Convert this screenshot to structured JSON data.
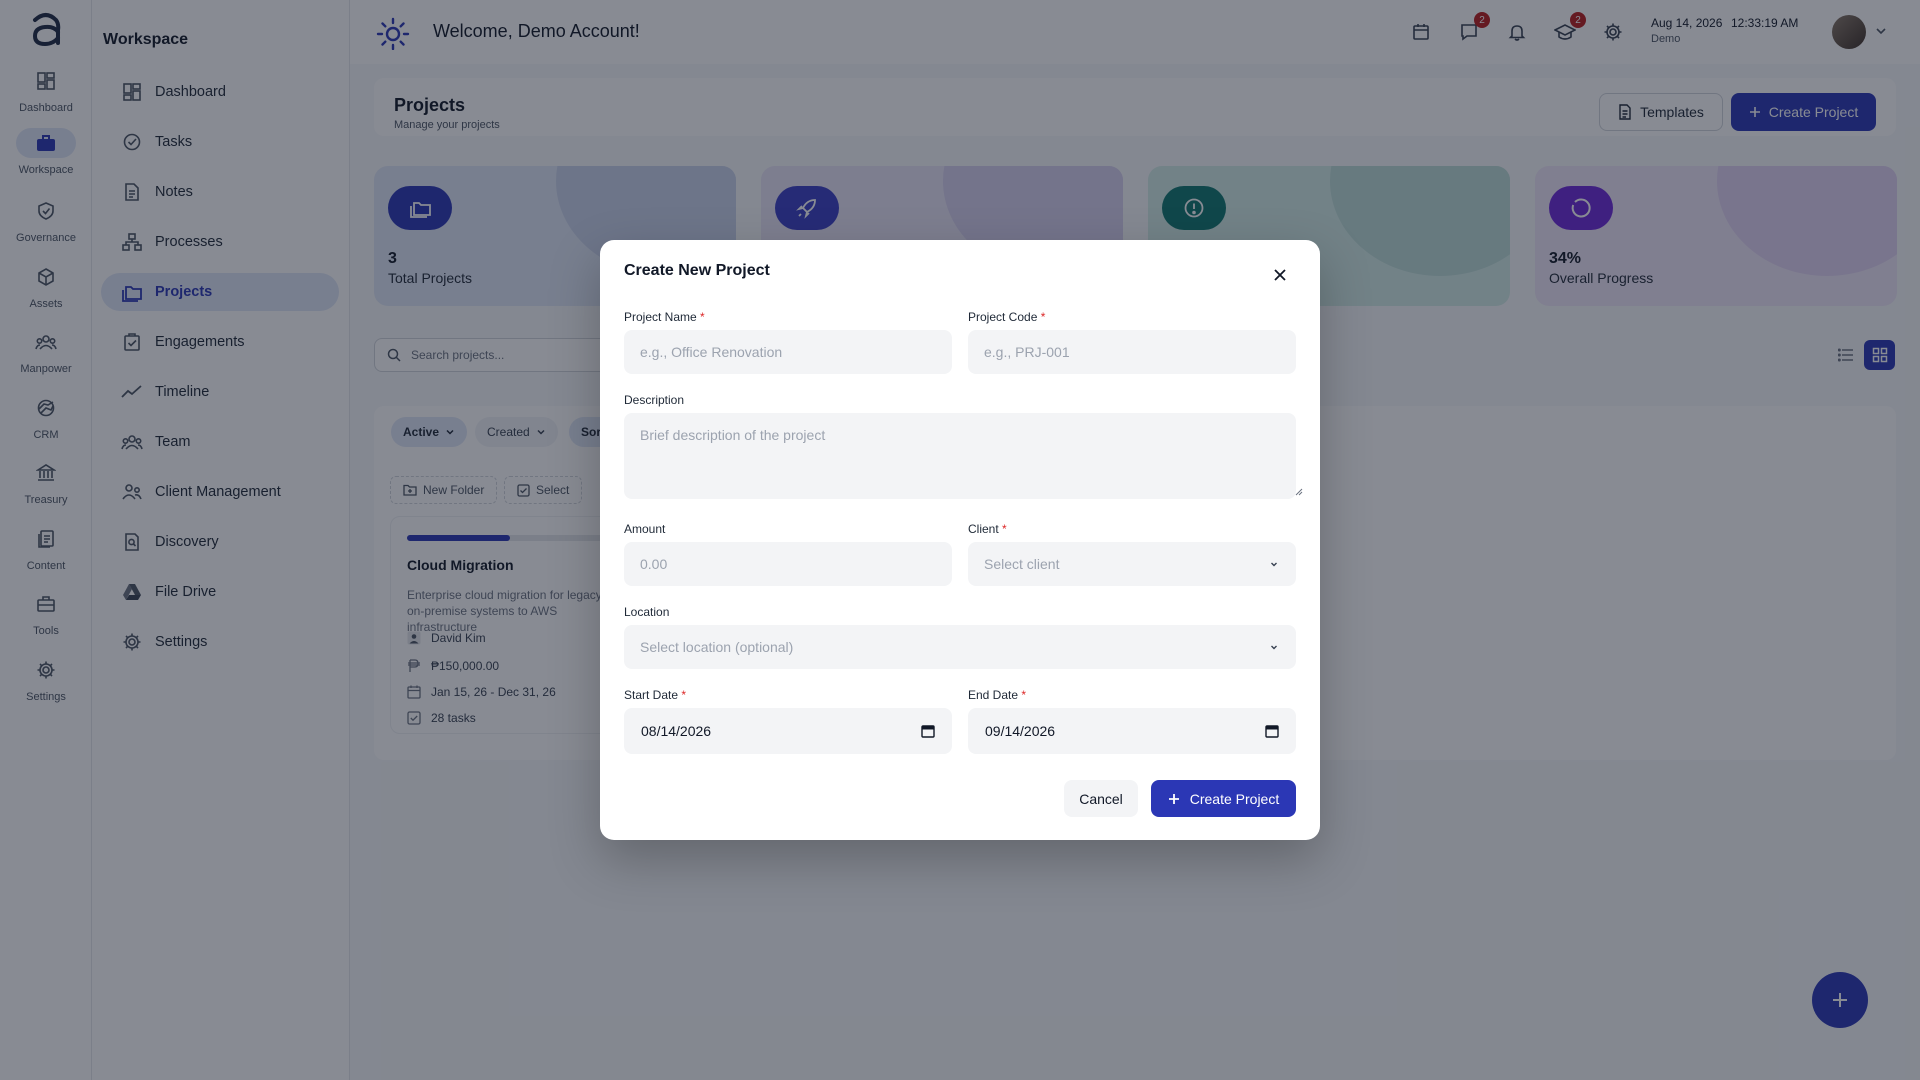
{
  "rail": {
    "items": [
      {
        "label": "Dashboard",
        "icon": "dashboard-grid-icon"
      },
      {
        "label": "Workspace",
        "icon": "briefcase-icon"
      },
      {
        "label": "Governance",
        "icon": "shield-check-icon"
      },
      {
        "label": "Assets",
        "icon": "cube-icon"
      },
      {
        "label": "Manpower",
        "icon": "people-icon"
      },
      {
        "label": "CRM",
        "icon": "handshake-icon"
      },
      {
        "label": "Treasury",
        "icon": "bank-icon"
      },
      {
        "label": "Content",
        "icon": "documents-icon"
      },
      {
        "label": "Tools",
        "icon": "toolbox-icon"
      },
      {
        "label": "Settings",
        "icon": "gear-icon"
      }
    ]
  },
  "sidebar": {
    "title": "Workspace",
    "items": [
      {
        "label": "Dashboard",
        "icon": "dashboard-grid-icon"
      },
      {
        "label": "Tasks",
        "icon": "check-circle-icon"
      },
      {
        "label": "Notes",
        "icon": "note-icon"
      },
      {
        "label": "Processes",
        "icon": "hierarchy-icon"
      },
      {
        "label": "Projects",
        "icon": "folders-icon",
        "active": true
      },
      {
        "label": "Engagements",
        "icon": "clipboard-check-icon"
      },
      {
        "label": "Timeline",
        "icon": "trend-line-icon"
      },
      {
        "label": "Team",
        "icon": "team-icon"
      },
      {
        "label": "Client Management",
        "icon": "clients-icon"
      },
      {
        "label": "Discovery",
        "icon": "search-document-icon"
      },
      {
        "label": "File Drive",
        "icon": "drive-icon"
      },
      {
        "label": "Settings",
        "icon": "gear-icon"
      }
    ]
  },
  "topbar": {
    "welcome": "Welcome, Demo Account!",
    "messages_badge": "2",
    "courses_badge": "2",
    "date": "Aug 14, 2026",
    "time": "12:33:19 AM",
    "user": "Demo"
  },
  "page": {
    "title": "Projects",
    "subtitle": "Manage your projects",
    "templates_label": "Templates",
    "create_label": "Create Project"
  },
  "stats": [
    {
      "value": "3",
      "label": "Total Projects",
      "color": "#2b37b5",
      "bg": "#dfe6f6",
      "blob": "#c9d3ea"
    },
    {
      "value": "",
      "label": "",
      "color": "#3b3fc4",
      "bg": "#e8e4f6",
      "blob": "#d6d0ee"
    },
    {
      "value": "",
      "label": "",
      "color": "#0f766e",
      "bg": "#d3ece6",
      "blob": "#bcdcd6"
    },
    {
      "value": "34%",
      "label": "Overall Progress",
      "color": "#6d28d9",
      "bg": "#efe6f8",
      "blob": "#e0d2f2"
    }
  ],
  "search": {
    "placeholder": "Search projects..."
  },
  "filters": {
    "active": "Active",
    "created": "Created",
    "sort": "Sort"
  },
  "toolbar": {
    "new_folder": "New Folder",
    "select": "Select"
  },
  "project_card": {
    "title": "Cloud Migration",
    "description": "Enterprise cloud migration for legacy on-premise systems to AWS infrastructure",
    "owner": "David Kim",
    "amount": "₱150,000.00",
    "dates": "Jan 15, 26 - Dec 31, 26",
    "tasks": "28 tasks",
    "progress": 0.41
  },
  "modal": {
    "title": "Create New Project",
    "project_name_label": "Project Name",
    "project_name_placeholder": "e.g., Office Renovation",
    "project_code_label": "Project Code",
    "project_code_placeholder": "e.g., PRJ-001",
    "description_label": "Description",
    "description_placeholder": "Brief description of the project",
    "amount_label": "Amount",
    "amount_placeholder": "0.00",
    "client_label": "Client",
    "client_placeholder": "Select client",
    "location_label": "Location",
    "location_placeholder": "Select location (optional)",
    "start_date_label": "Start Date",
    "start_date_value": "08/14/2026",
    "end_date_label": "End Date",
    "end_date_value": "09/14/2026",
    "required_mark": "*",
    "cancel_label": "Cancel",
    "create_label": "Create Project"
  },
  "colors": {
    "accent": "#2b37b5",
    "required": "#dc2626",
    "badge": "#b91c1c"
  }
}
